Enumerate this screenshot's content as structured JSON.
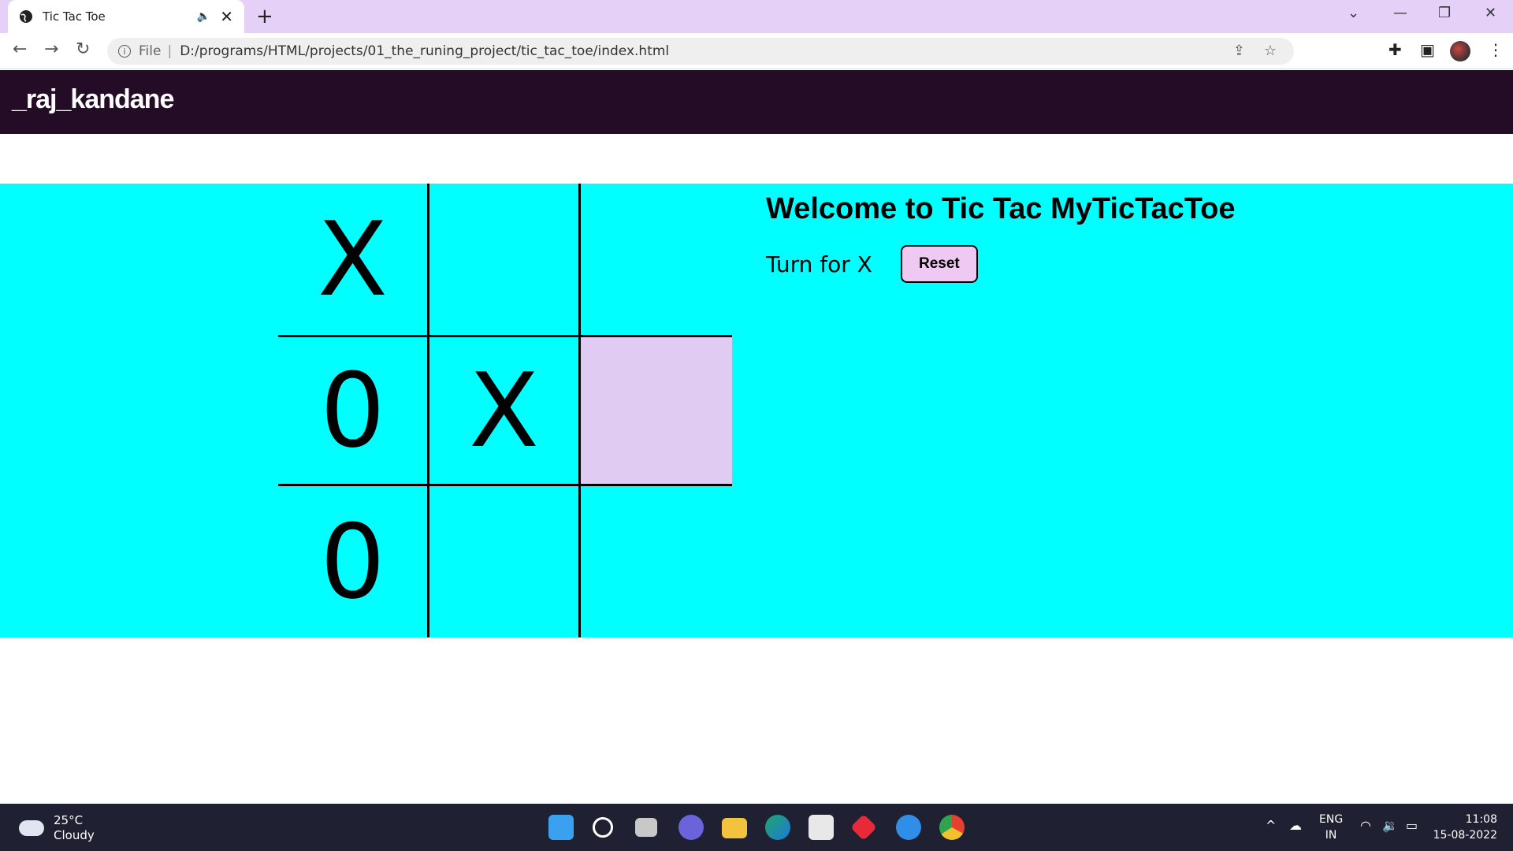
{
  "browser": {
    "tab_title": "Tic Tac Toe",
    "tab_close": "✕",
    "new_tab": "+",
    "url_prefix": "File",
    "url": "D:/programs/HTML/projects/01_the_runing_project/tic_tac_toe/index.html"
  },
  "navbar": {
    "brand": "_raj_kandane"
  },
  "game": {
    "cells": [
      "X",
      "",
      "",
      "0",
      "X",
      "",
      "0",
      "",
      ""
    ],
    "highlighted_cell": 5,
    "title": "Welcome to Tic Tac MyTicTacToe",
    "turn_text": "Turn for X",
    "reset_label": "Reset"
  },
  "colors": {
    "navbar_bg": "#250c26",
    "board_bg": "#00ffff",
    "highlight": "#e0cbf2",
    "reset_bg": "#f0c9f3",
    "tabstrip": "#e5d0f7"
  },
  "taskbar": {
    "temperature": "25°C",
    "weather": "Cloudy",
    "lang_top": "ENG",
    "lang_bottom": "IN",
    "time": "11:08",
    "date": "15-08-2022"
  }
}
